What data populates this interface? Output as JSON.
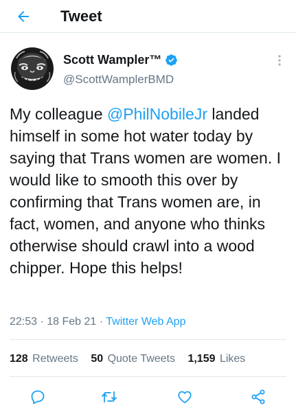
{
  "header": {
    "title": "Tweet",
    "back_icon": "arrow-left-icon"
  },
  "author": {
    "name": "Scott Wampler™",
    "handle": "@ScottWamplerBMD",
    "verified": true,
    "avatar": "creature-avatar"
  },
  "tweet": {
    "text_before_mention": "My colleague ",
    "mention": "@PhilNobileJr",
    "text_after_mention": " landed himself in some hot water today by saying that Trans women are women. I would like to smooth this over by confirming that Trans women are, in fact, women, and anyone who thinks otherwise should crawl into a wood chipper. Hope this helps!"
  },
  "meta": {
    "time": "22:53",
    "separator": " · ",
    "date": "18 Feb 21",
    "source": "Twitter Web App"
  },
  "stats": {
    "retweets_count": "128",
    "retweets_label": "Retweets",
    "quote_tweets_count": "50",
    "quote_tweets_label": "Quote Tweets",
    "likes_count": "1,159",
    "likes_label": "Likes"
  },
  "actions": [
    "reply-icon",
    "retweet-icon",
    "like-icon",
    "share-icon"
  ],
  "colors": {
    "accent": "#1da1f2",
    "text": "#14171a",
    "secondary": "#657786",
    "divider": "#e1e8ed"
  }
}
